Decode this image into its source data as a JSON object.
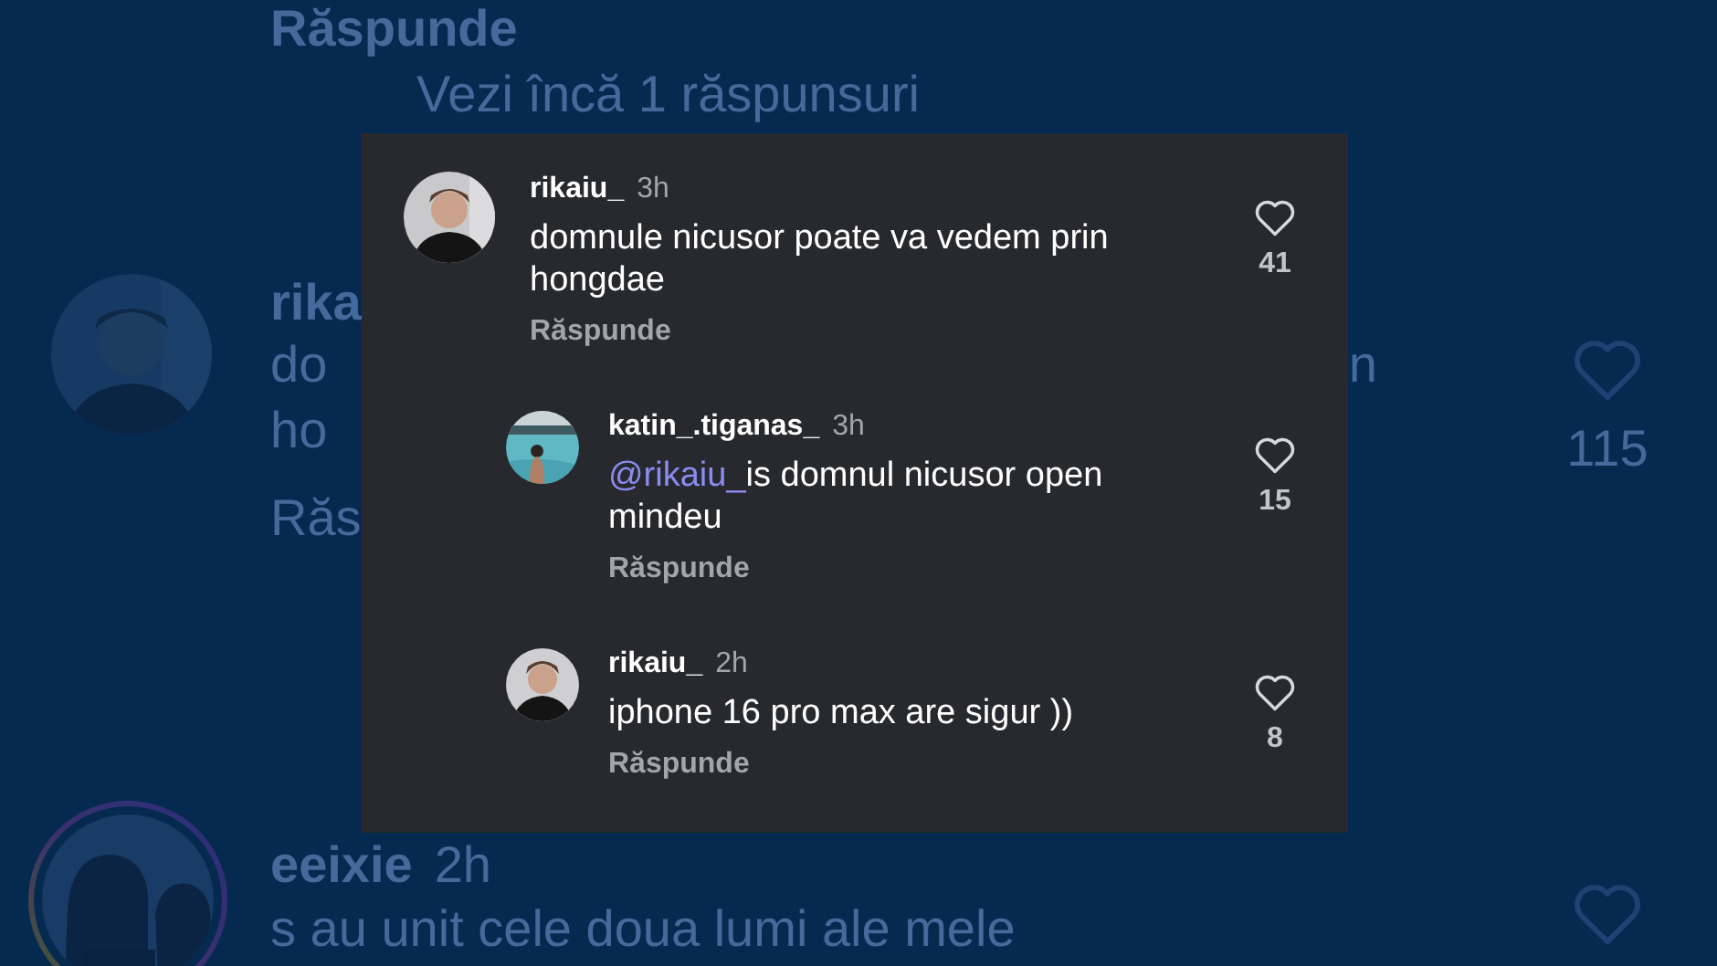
{
  "background": {
    "top_reply_label": "Răspunde",
    "view_more": "Vezi încă 1 răspunsuri",
    "comments": [
      {
        "username": "rika",
        "text_lines": [
          "do",
          "ho"
        ],
        "text_end": "n",
        "reply_label": "Răs",
        "likes": "115",
        "liked": false
      },
      {
        "username": "eeixie",
        "time": "2h",
        "text_lines": [
          "s au unit cele doua lumi ale mele"
        ],
        "liked": false
      }
    ]
  },
  "thread": {
    "username": "rikaiu_",
    "time": "3h",
    "text": "domnule nicusor poate va vedem prin hongdae",
    "reply_label": "Răspunde",
    "likes": "41",
    "liked": false,
    "children": [
      {
        "username": "katin_.tiganas_",
        "time": "3h",
        "mention": "@rikaiu_",
        "text": "is domnul nicusor open mindeu",
        "reply_label": "Răspunde",
        "likes": "15",
        "liked": false
      },
      {
        "username": "rikaiu_",
        "time": "2h",
        "text": "iphone 16 pro max are sigur ))",
        "reply_label": "Răspunde",
        "likes": "8",
        "liked": false
      }
    ]
  }
}
